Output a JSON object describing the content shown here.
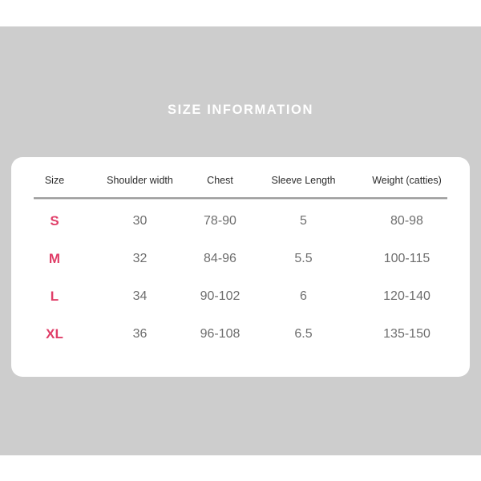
{
  "title": "SIZE INFORMATION",
  "colors": {
    "background": "#cdcdcd",
    "card": "#ffffff",
    "title_text": "#ffffff",
    "size_label": "#e03e68",
    "value_text": "#6e6e6e",
    "header_text": "#2b2b2b",
    "divider": "#9d9d9d"
  },
  "table": {
    "headers": [
      "Size",
      "Shoulder width",
      "Chest",
      "Sleeve Length",
      "Weight (catties)"
    ],
    "rows": [
      {
        "size": "S",
        "shoulder_width": "30",
        "chest": "78-90",
        "sleeve_length": "5",
        "weight": "80-98"
      },
      {
        "size": "M",
        "shoulder_width": "32",
        "chest": "84-96",
        "sleeve_length": "5.5",
        "weight": "100-115"
      },
      {
        "size": "L",
        "shoulder_width": "34",
        "chest": "90-102",
        "sleeve_length": "6",
        "weight": "120-140"
      },
      {
        "size": "XL",
        "shoulder_width": "36",
        "chest": "96-108",
        "sleeve_length": "6.5",
        "weight": "135-150"
      }
    ]
  }
}
